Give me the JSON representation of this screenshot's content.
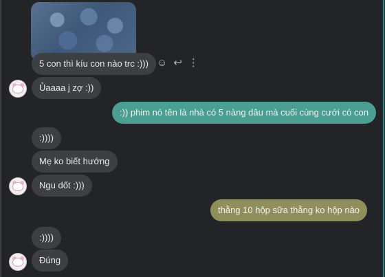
{
  "messages": [
    {
      "text": "5 con thì kíu con nào trc :)))"
    },
    {
      "text": "Ủaaaa j zợ :))"
    },
    {
      "text": ":)) phim nó tên là nhà có 5 nàng dâu mà cuối cùng cưới có con"
    },
    {
      "text": ":))))"
    },
    {
      "text": "Mẹ ko biết hướng"
    },
    {
      "text": "Ngu dốt :)))"
    },
    {
      "text": "thằng 10 hộp sữa thằng ko hộp nào"
    },
    {
      "text": ":))))"
    },
    {
      "text": "Đúng"
    }
  ],
  "icons": {
    "react": "smile-icon",
    "reply": "reply-icon",
    "more": "more-icon"
  },
  "colors": {
    "background": "#232427",
    "incoming_bubble": "#3e3f43",
    "outgoing_teal": "#4a9e92",
    "outgoing_olive": "#8f8f5c"
  }
}
